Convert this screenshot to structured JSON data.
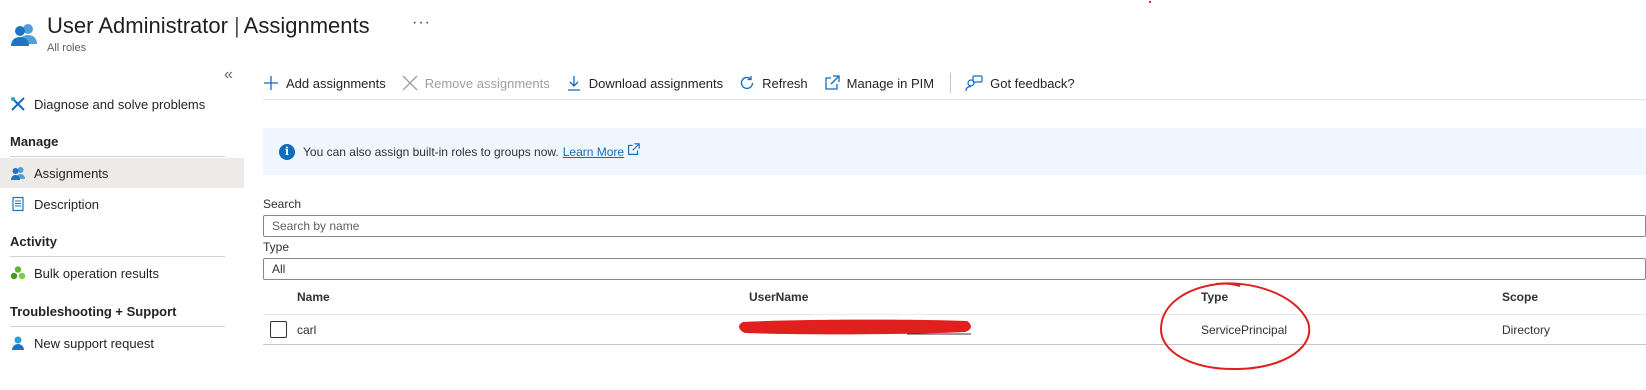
{
  "header": {
    "title": "User Administrator",
    "section": "Assignments",
    "subtitle": "All roles",
    "more": "···"
  },
  "sidebar": {
    "collapse": "«",
    "items": [
      {
        "label": "Diagnose and solve problems",
        "icon": "wrench-icon"
      },
      {
        "label": "Assignments",
        "icon": "users-icon",
        "active": true
      },
      {
        "label": "Description",
        "icon": "document-icon"
      },
      {
        "label": "Bulk operation results",
        "icon": "bulk-icon"
      },
      {
        "label": "New support request",
        "icon": "support-icon"
      }
    ],
    "groups": {
      "manage": "Manage",
      "activity": "Activity",
      "troubleshooting": "Troubleshooting + Support"
    }
  },
  "toolbar": {
    "add": "Add assignments",
    "remove": "Remove assignments",
    "download": "Download assignments",
    "refresh": "Refresh",
    "pim": "Manage in PIM",
    "feedback": "Got feedback?"
  },
  "info": {
    "message": "You can also assign built-in roles to groups now.",
    "link": "Learn More"
  },
  "filters": {
    "search_label": "Search",
    "search_placeholder": "Search by name",
    "type_label": "Type",
    "type_value": "All"
  },
  "table": {
    "columns": [
      "Name",
      "UserName",
      "Type",
      "Scope"
    ],
    "rows": [
      {
        "name": "carl",
        "username": "",
        "type": "ServicePrincipal",
        "scope": "Directory"
      }
    ]
  },
  "colors": {
    "accent": "#0f6cbd",
    "annotation_red": "#e0201f",
    "info_bg": "#f0f6ff"
  }
}
